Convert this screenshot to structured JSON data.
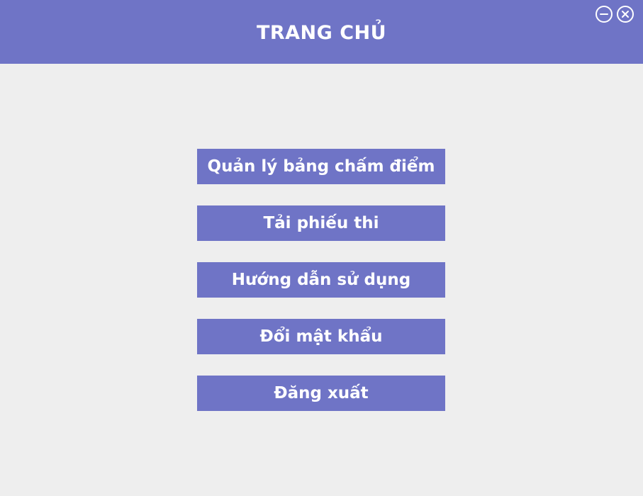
{
  "window": {
    "title": "TRANG CHỦ",
    "controls": {
      "minimize_icon": "minimize-circle-icon",
      "close_icon": "close-circle-icon"
    }
  },
  "menu": {
    "items": [
      {
        "label": "Quản lý bảng chấm điểm"
      },
      {
        "label": "Tải phiếu thi"
      },
      {
        "label": "Hướng dẫn sử dụng"
      },
      {
        "label": "Đổi mật khẩu"
      },
      {
        "label": "Đăng xuất"
      }
    ]
  },
  "colors": {
    "accent": "#6f74c6",
    "background": "#eeeeee",
    "text_on_accent": "#ffffff"
  }
}
